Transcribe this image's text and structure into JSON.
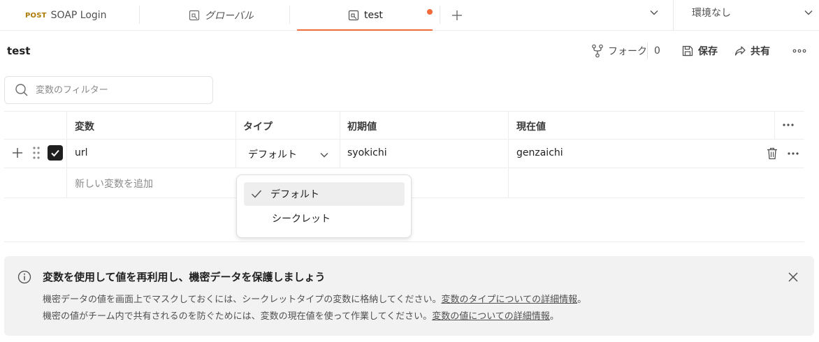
{
  "tabs": [
    {
      "method": "POST",
      "label": "SOAP Login",
      "active": false
    },
    {
      "label": "グローバル",
      "active": false
    },
    {
      "label": "test",
      "active": true,
      "unsaved": true
    }
  ],
  "environment": {
    "selected": "環境なし"
  },
  "colors": {
    "accent": "#f26b3a",
    "method_post": "#ad7a03"
  },
  "header": {
    "title": "test",
    "fork_label": "フォーク",
    "fork_count": "0",
    "save_label": "保存",
    "share_label": "共有"
  },
  "filter": {
    "placeholder": "変数のフィルター"
  },
  "table": {
    "columns": [
      "変数",
      "タイプ",
      "初期値",
      "現在値"
    ],
    "rows": [
      {
        "checked": true,
        "variable": "url",
        "type": "デフォルト",
        "initial": "syokichi",
        "current": "genzaichi"
      }
    ],
    "add_placeholder": "新しい変数を追加"
  },
  "type_menu": {
    "options": [
      "デフォルト",
      "シークレット"
    ],
    "selected": "デフォルト"
  },
  "banner": {
    "title": "変数を使用して値を再利用し、機密データを保護しましょう",
    "line1_text": "機密データの値を画面上でマスクしておくには、シークレットタイプの変数に格納してください。",
    "line1_link": "変数のタイプについての詳細情報",
    "line2_text": "機密の値がチーム内で共有されるのを防ぐためには、変数の現在値を使って作業してください。",
    "line2_link": "変数の値についての詳細情報",
    "period": "。"
  }
}
